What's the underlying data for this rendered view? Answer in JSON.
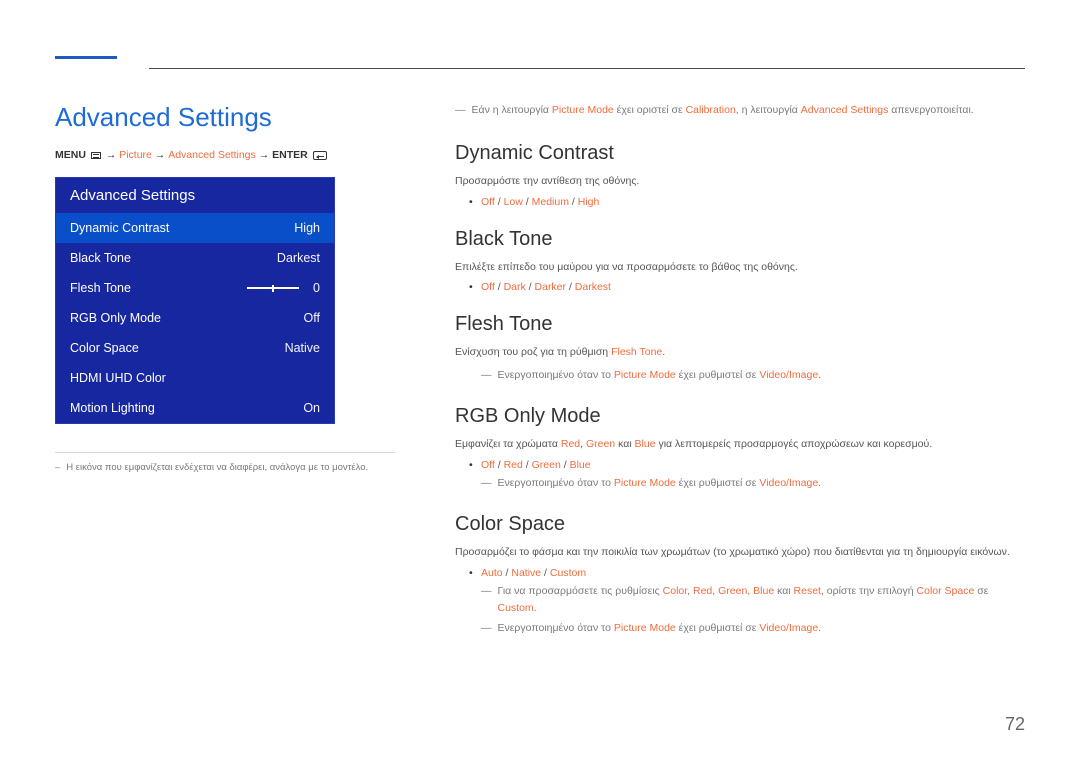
{
  "top": {
    "title": "Advanced Settings",
    "bc_menu": "MENU",
    "bc_picture": "Picture",
    "bc_adv": "Advanced Settings",
    "bc_enter": "ENTER"
  },
  "panel": {
    "header": "Advanced Settings",
    "rows": [
      {
        "label": "Dynamic Contrast",
        "val": "High",
        "sel": true
      },
      {
        "label": "Black Tone",
        "val": "Darkest"
      },
      {
        "label": "Flesh Tone",
        "val": "0",
        "slider": true
      },
      {
        "label": "RGB Only Mode",
        "val": "Off"
      },
      {
        "label": "Color Space",
        "val": "Native"
      },
      {
        "label": "HDMI UHD Color",
        "val": ""
      },
      {
        "label": "Motion Lighting",
        "val": "On"
      }
    ]
  },
  "leftnote": "Η εικόνα που εμφανίζεται ενδέχεται να διαφέρει, ανάλογα με το μοντέλο.",
  "intro": {
    "t1": "Εάν η λειτουργία ",
    "kw1": "Picture Mode",
    "t2": " έχει οριστεί σε ",
    "kw2": "Calibration",
    "t3": ", η λειτουργία ",
    "kw3": "Advanced Settings",
    "t4": " απενεργοποιείται."
  },
  "dc": {
    "h": "Dynamic Contrast",
    "d": "Προσαρμόστε την αντίθεση της οθόνης.",
    "opts": [
      "Off",
      "Low",
      "Medium",
      "High"
    ]
  },
  "bt": {
    "h": "Black Tone",
    "d": "Επιλέξτε επίπεδο του μαύρου για να προσαρμόσετε το βάθος της οθόνης.",
    "opts": [
      "Off",
      "Dark",
      "Darker",
      "Darkest"
    ]
  },
  "ft": {
    "h": "Flesh Tone",
    "d1": "Ενίσχυση του ροζ για τη ρύθμιση ",
    "kw_d1": "Flesh Tone",
    "d1b": ".",
    "n1": "Ενεργοποιημένο όταν το ",
    "kw_n1": "Picture Mode",
    "n1b": " έχει ρυθμιστεί σε ",
    "kw_n1c": "Video/Image",
    "n1d": "."
  },
  "rgb": {
    "h": "RGB Only Mode",
    "d1": "Εμφανίζει τα χρώματα ",
    "kw1": "Red",
    "d2": ", ",
    "kw2": "Green",
    "d3": " και ",
    "kw3": "Blue",
    "d4": " για λεπτομερείς προσαρμογές αποχρώσεων και κορεσμού.",
    "opts": [
      "Off",
      "Red",
      "Green",
      "Blue"
    ],
    "n1": "Ενεργοποιημένο όταν το ",
    "kw_n1": "Picture Mode",
    "n1b": " έχει ρυθμιστεί σε ",
    "kw_n1c": "Video/Image",
    "n1d": "."
  },
  "cs": {
    "h": "Color Space",
    "d": "Προσαρμόζει το φάσμα και την ποικιλία των χρωμάτων (το χρωματικό χώρο) που διατίθενται για τη δημιουργία εικόνων.",
    "opts": [
      "Auto",
      "Native",
      "Custom"
    ],
    "n1a": "Για να προσαρμόσετε τις ρυθμίσεις ",
    "kw1": "Color",
    "s1": ", ",
    "kw2": "Red",
    "s2": ", ",
    "kw3": "Green",
    "s3": ", ",
    "kw4": "Blue",
    "n1b": " και ",
    "kw5": "Reset",
    "n1c": ", ορίστε την επιλογή ",
    "kw6": "Color Space",
    "n1d": " σε ",
    "kw7": "Custom",
    "n1e": ".",
    "n2a": "Ενεργοποιημένο όταν το ",
    "kw_n2a": "Picture Mode",
    "n2b": " έχει ρυθμιστεί σε ",
    "kw_n2c": "Video/Image",
    "n2d": "."
  },
  "pagenum": "72"
}
